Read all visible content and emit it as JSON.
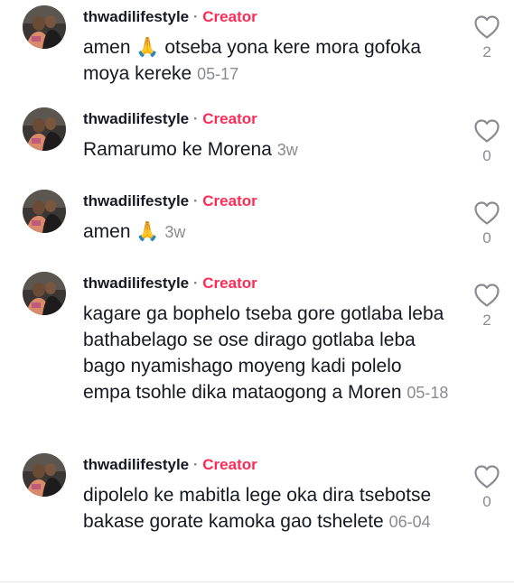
{
  "separator": "·",
  "comments": [
    {
      "username": "thwadilifestyle",
      "badge": "Creator",
      "text": "amen 🙏 otseba yona kere mora gofoka moya kereke",
      "time": "05-17",
      "likes": "2"
    },
    {
      "username": "thwadilifestyle",
      "badge": "Creator",
      "text": "Ramarumo ke Morena",
      "time": "3w",
      "likes": "0"
    },
    {
      "username": "thwadilifestyle",
      "badge": "Creator",
      "text": "amen 🙏",
      "time": "3w",
      "likes": "0"
    },
    {
      "username": "thwadilifestyle",
      "badge": "Creator",
      "text": "kagare ga bophelo tseba gore gotlaba leba bathabelago se ose dirago gotlaba leba bago nyamishago moyeng kadi polelo empa tsohle dika mataogong a Moren",
      "time": "05-18",
      "likes": "2"
    },
    {
      "username": "thwadilifestyle",
      "badge": "Creator",
      "text": "dipolelo ke mabitla lege oka dira tsebotse bakase gorate kamoka gao tshelete",
      "time": "06-04",
      "likes": "0"
    }
  ],
  "colors": {
    "creator_badge": "#fe2c55",
    "secondary_text": "#8a8b91",
    "primary_text": "#161823"
  },
  "icons": {
    "like": "heart-outline-icon",
    "avatar": "profile-photo"
  }
}
